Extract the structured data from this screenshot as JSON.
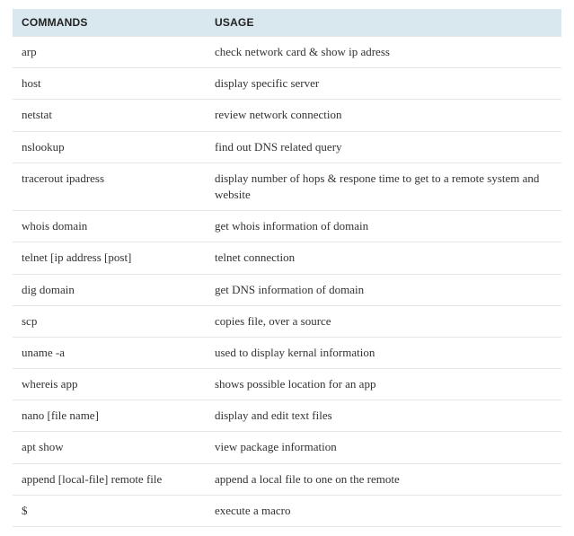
{
  "table": {
    "headers": {
      "commands": "COMMANDS",
      "usage": "USAGE"
    },
    "rows": [
      {
        "command": "arp",
        "usage": "check network card & show ip adress"
      },
      {
        "command": "host",
        "usage": "display specific server"
      },
      {
        "command": "netstat",
        "usage": "review network connection"
      },
      {
        "command": "nslookup",
        "usage": "find out DNS related query"
      },
      {
        "command": "tracerout ipadress",
        "usage": "display number of hops & respone time to get to a remote system and website"
      },
      {
        "command": "whois domain",
        "usage": "get whois information of domain"
      },
      {
        "command": "telnet [ip address [post]",
        "usage": "telnet connection"
      },
      {
        "command": "dig domain",
        "usage": "get DNS information of domain"
      },
      {
        "command": "scp",
        "usage": "copies file, over a source"
      },
      {
        "command": "uname -a",
        "usage": "used to display kernal information"
      },
      {
        "command": "whereis app",
        "usage": "shows possible location for an app"
      },
      {
        "command": "nano [file name]",
        "usage": "display and edit text files"
      },
      {
        "command": "apt show",
        "usage": "view package information"
      },
      {
        "command": "append [local-file] remote file",
        "usage": "append a local file to one on the remote"
      },
      {
        "command": "$",
        "usage": "execute a macro"
      }
    ]
  }
}
